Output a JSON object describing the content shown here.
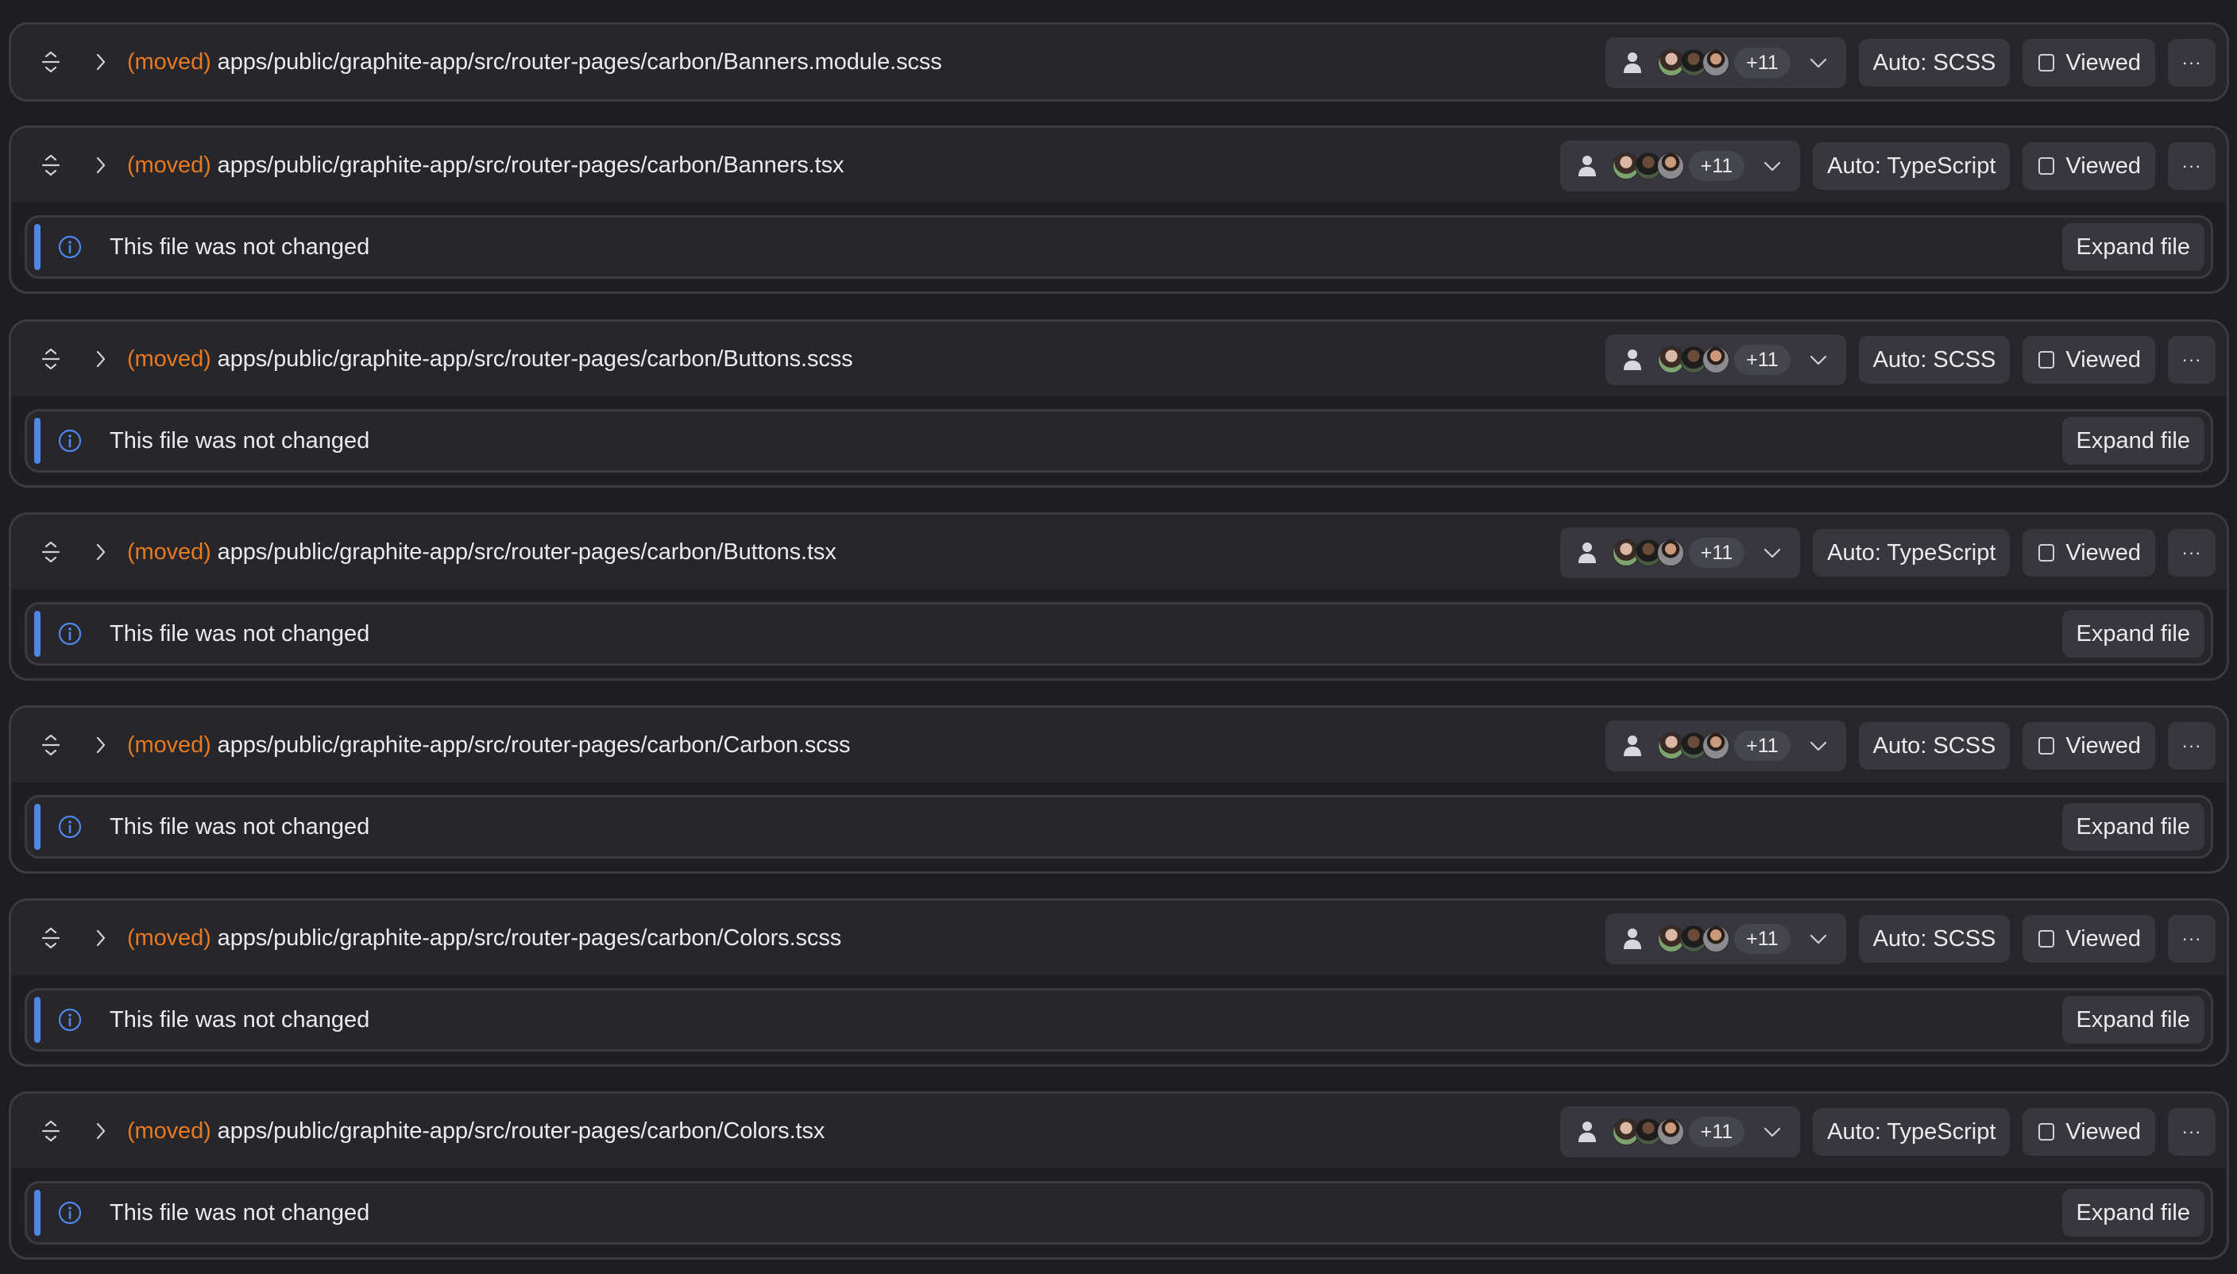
{
  "colors": {
    "background": "#1e1e21",
    "card_header": "#26262b",
    "moved_label": "#e57a22",
    "notice_accent": "#4f86e8",
    "button_bg": "#37373d"
  },
  "files": [
    {
      "status": "(moved)",
      "path": "apps/public/graphite-app/src/router-pages/carbon/Banners.module.scss",
      "reviewers_count": "+11",
      "language": "Auto: SCSS",
      "viewed_label": "Viewed",
      "more_label": "···",
      "notice": null
    },
    {
      "status": "(moved)",
      "path": "apps/public/graphite-app/src/router-pages/carbon/Banners.tsx",
      "reviewers_count": "+11",
      "language": "Auto: TypeScript",
      "viewed_label": "Viewed",
      "more_label": "···",
      "notice": {
        "message": "This file was not changed",
        "action": "Expand file"
      }
    },
    {
      "status": "(moved)",
      "path": "apps/public/graphite-app/src/router-pages/carbon/Buttons.scss",
      "reviewers_count": "+11",
      "language": "Auto: SCSS",
      "viewed_label": "Viewed",
      "more_label": "···",
      "notice": {
        "message": "This file was not changed",
        "action": "Expand file"
      }
    },
    {
      "status": "(moved)",
      "path": "apps/public/graphite-app/src/router-pages/carbon/Buttons.tsx",
      "reviewers_count": "+11",
      "language": "Auto: TypeScript",
      "viewed_label": "Viewed",
      "more_label": "···",
      "notice": {
        "message": "This file was not changed",
        "action": "Expand file"
      }
    },
    {
      "status": "(moved)",
      "path": "apps/public/graphite-app/src/router-pages/carbon/Carbon.scss",
      "reviewers_count": "+11",
      "language": "Auto: SCSS",
      "viewed_label": "Viewed",
      "more_label": "···",
      "notice": {
        "message": "This file was not changed",
        "action": "Expand file"
      }
    },
    {
      "status": "(moved)",
      "path": "apps/public/graphite-app/src/router-pages/carbon/Colors.scss",
      "reviewers_count": "+11",
      "language": "Auto: SCSS",
      "viewed_label": "Viewed",
      "more_label": "···",
      "notice": {
        "message": "This file was not changed",
        "action": "Expand file"
      }
    },
    {
      "status": "(moved)",
      "path": "apps/public/graphite-app/src/router-pages/carbon/Colors.tsx",
      "reviewers_count": "+11",
      "language": "Auto: TypeScript",
      "viewed_label": "Viewed",
      "more_label": "···",
      "notice": {
        "message": "This file was not changed",
        "action": "Expand file"
      }
    }
  ]
}
